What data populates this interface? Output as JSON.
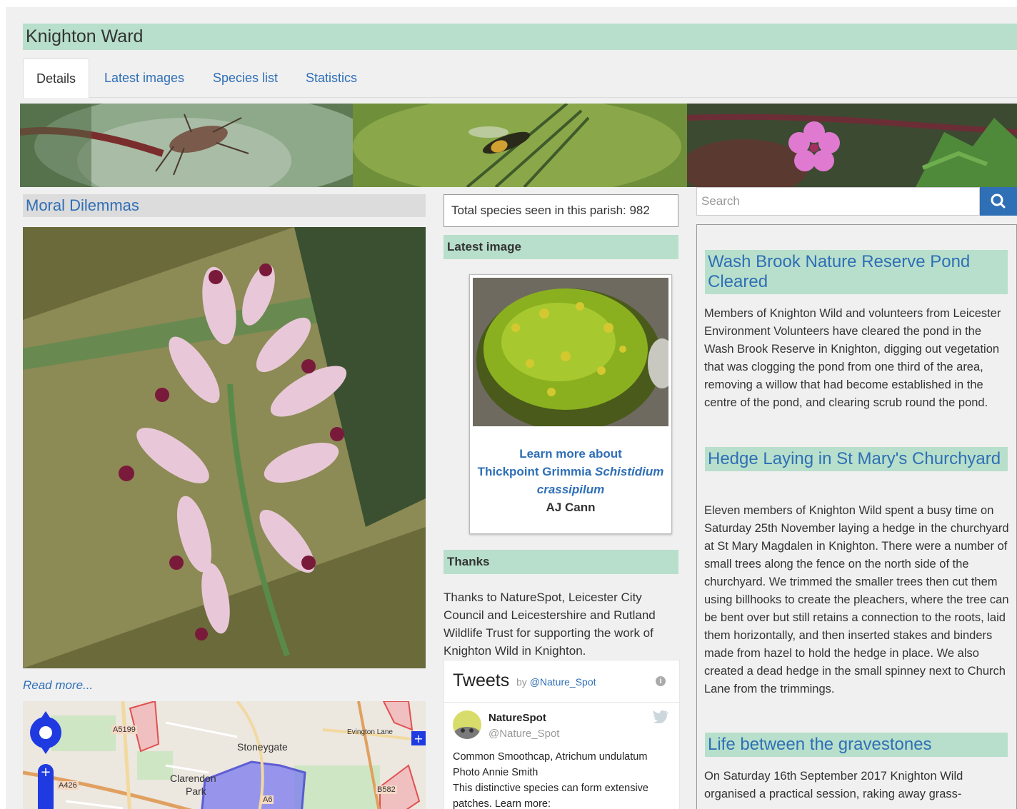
{
  "page_title": "Knighton Ward",
  "tabs": [
    {
      "label": "Details",
      "active": true
    },
    {
      "label": "Latest images",
      "active": false
    },
    {
      "label": "Species list",
      "active": false
    },
    {
      "label": "Statistics",
      "active": false
    }
  ],
  "left": {
    "heading": "Moral Dilemmas",
    "read_more": "Read more...",
    "map": {
      "labels": [
        "Stoneygate",
        "Clarendon",
        "Park",
        "Evington Lane"
      ],
      "roads": [
        "A5199",
        "A426",
        "A6",
        "B582"
      ]
    }
  },
  "middle": {
    "total_species": "Total species seen in this parish: 982",
    "latest_image_heading": "Latest image",
    "learn_more_prefix": "Learn more about",
    "species_common": "Thickpoint Grimmia",
    "species_latin": "Schistidium crassipilum",
    "photographer": "AJ Cann",
    "thanks_heading": "Thanks",
    "thanks_text": "Thanks to NatureSpot, Leicester City Council and Leicestershire and Rutland Wildlife Trust for supporting the work of Knighton Wild in Knighton.",
    "tweets": {
      "title": "Tweets",
      "by": "by",
      "handle_link": "@Nature_Spot",
      "author_name": "NatureSpot",
      "author_handle": "@Nature_Spot",
      "text_line1": "Common Smoothcap, Atrichum undulatum",
      "text_line2": "Photo Annie Smith",
      "text_line3": "This distinctive species can form extensive patches. Learn more:"
    }
  },
  "right": {
    "search_placeholder": "Search",
    "news": [
      {
        "title": "Wash Brook Nature Reserve Pond Cleared",
        "body": "Members of Knighton Wild and volunteers from Leicester Environment Volunteers have cleared the pond in the Wash Brook Reserve in Knighton, digging out vegetation that was clogging the pond from one third of the area, removing a willow that had become established in the centre of the pond, and clearing scrub round the pond."
      },
      {
        "title": "Hedge Laying in St Mary's Churchyard",
        "body": "Eleven members of Knighton Wild spent a busy time on Saturday 25th November laying a hedge in the churchyard at St Mary Magdalen in Knighton.  There were a number of small trees along the fence on the north side of the churchyard.  We trimmed the smaller trees then cut them using billhooks to create the pleachers, where the tree can be bent over but still retains a connection to the roots, laid them horizontally, and then inserted stakes and binders made from hazel to hold the hedge in place. We also created a dead hedge in the small spinney next to Church Lane from the trimmings."
      },
      {
        "title": "Life between the gravestones",
        "body": "On Saturday 16th September 2017 Knighton Wild organised a practical session, raking away grass-"
      }
    ]
  },
  "colors": {
    "accent_green": "#b7dfcb",
    "link_blue": "#2f6fb6",
    "background": "#f0f0f0"
  }
}
